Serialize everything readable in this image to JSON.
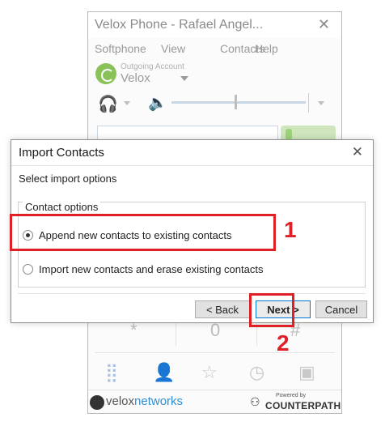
{
  "phone_window": {
    "title": "Velox Phone - Rafael Angel...",
    "close_glyph": "✕",
    "menu": [
      "Softphone",
      "View",
      "Contacts",
      "Help"
    ],
    "account_label": "Outgoing Account",
    "account_name": "Velox",
    "dialpad_keys": [
      "*",
      "0",
      "#"
    ],
    "footer": {
      "velox_prefix": "velox",
      "velox_suffix": "networks",
      "powered_by": "Powered by",
      "counterpath": "COUNTERPATH"
    }
  },
  "dialog": {
    "title": "Import Contacts",
    "close_glyph": "✕",
    "subtitle": "Select import options",
    "group_label": "Contact options",
    "options": [
      {
        "label": "Append new contacts to existing contacts",
        "checked": true
      },
      {
        "label": "Import new contacts and erase existing contacts",
        "checked": false
      }
    ],
    "buttons": {
      "back": "< Back",
      "next": "Next >",
      "cancel": "Cancel"
    }
  },
  "annotations": {
    "marker_1": "1",
    "marker_2": "2",
    "color": "#e02027"
  },
  "colors": {
    "accent_green": "#8ac25a",
    "link_blue": "#2f8fd3",
    "default_button_border": "#0078d7"
  }
}
